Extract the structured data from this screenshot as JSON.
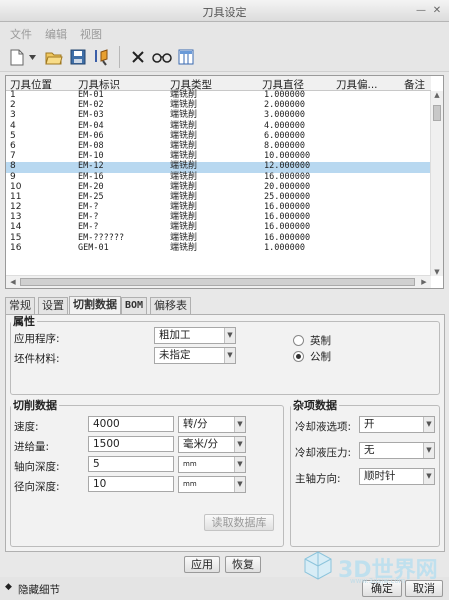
{
  "window": {
    "title": "刀具设定"
  },
  "menu": [
    "文件",
    "编辑",
    "视图"
  ],
  "toolbar": [
    "new-tool-icon",
    "dropdown-icon",
    "open-icon",
    "save-icon",
    "tool-edit-icon",
    "delete-icon",
    "view-icon",
    "columns-icon"
  ],
  "table": {
    "headers": [
      "刀具位置",
      "刀具标识",
      "刀具类型",
      "刀具直径",
      "刀具偏...",
      "备注"
    ],
    "rows": [
      [
        "1",
        "EM-01",
        "端铣削",
        "1.000000"
      ],
      [
        "2",
        "EM-02",
        "端铣削",
        "2.000000"
      ],
      [
        "3",
        "EM-03",
        "端铣削",
        "3.000000"
      ],
      [
        "4",
        "EM-04",
        "端铣削",
        "4.000000"
      ],
      [
        "5",
        "EM-06",
        "端铣削",
        "6.000000"
      ],
      [
        "6",
        "EM-08",
        "端铣削",
        "8.000000"
      ],
      [
        "7",
        "EM-10",
        "端铣削",
        "10.000000"
      ],
      [
        "8",
        "EM-12",
        "端铣削",
        "12.000000"
      ],
      [
        "9",
        "EM-16",
        "端铣削",
        "16.000000"
      ],
      [
        "10",
        "EM-20",
        "端铣削",
        "20.000000"
      ],
      [
        "11",
        "EM-25",
        "端铣削",
        "25.000000"
      ],
      [
        "12",
        "EM-?",
        "端铣削",
        "16.000000"
      ],
      [
        "13",
        "EM-?",
        "端铣削",
        "16.000000"
      ],
      [
        "14",
        "EM-?",
        "端铣削",
        "16.000000"
      ],
      [
        "15",
        "EM-??????",
        "端铣削",
        "16.000000"
      ],
      [
        "16",
        "GEM-01",
        "端铣削",
        "1.000000"
      ]
    ],
    "selected_row": 7
  },
  "tabs": [
    "常规",
    "设置",
    "切割数据",
    "BOM",
    "偏移表"
  ],
  "active_tab": 2,
  "properties": {
    "legend": "属性",
    "app_label": "应用程序:",
    "app_value": "粗加工",
    "material_label": "坯件材料:",
    "material_value": "未指定",
    "unit_imperial": "英制",
    "unit_metric": "公制",
    "unit_selected": "公制"
  },
  "cutting": {
    "legend": "切削数据",
    "speed_label": "速度:",
    "speed_value": "4000",
    "speed_unit": "转/分",
    "feed_label": "进给量:",
    "feed_value": "1500",
    "feed_unit": "毫米/分",
    "axial_label": "轴向深度:",
    "axial_value": "5",
    "axial_unit": "mm",
    "radial_label": "径向深度:",
    "radial_value": "10",
    "radial_unit": "mm",
    "read_db_button": "读取数据库"
  },
  "misc": {
    "legend": "杂项数据",
    "coolant_label": "冷却液选项:",
    "coolant_value": "开",
    "pressure_label": "冷却液压力:",
    "pressure_value": "无",
    "spindle_label": "主轴方向:",
    "spindle_value": "顺时针"
  },
  "actions": {
    "apply": "应用",
    "restore": "恢复",
    "ok": "确定",
    "cancel": "取消"
  },
  "footer": {
    "hide_details": "隐藏细节"
  },
  "watermark": {
    "text": "3D世界网",
    "url": "www.3dsjw.com"
  }
}
